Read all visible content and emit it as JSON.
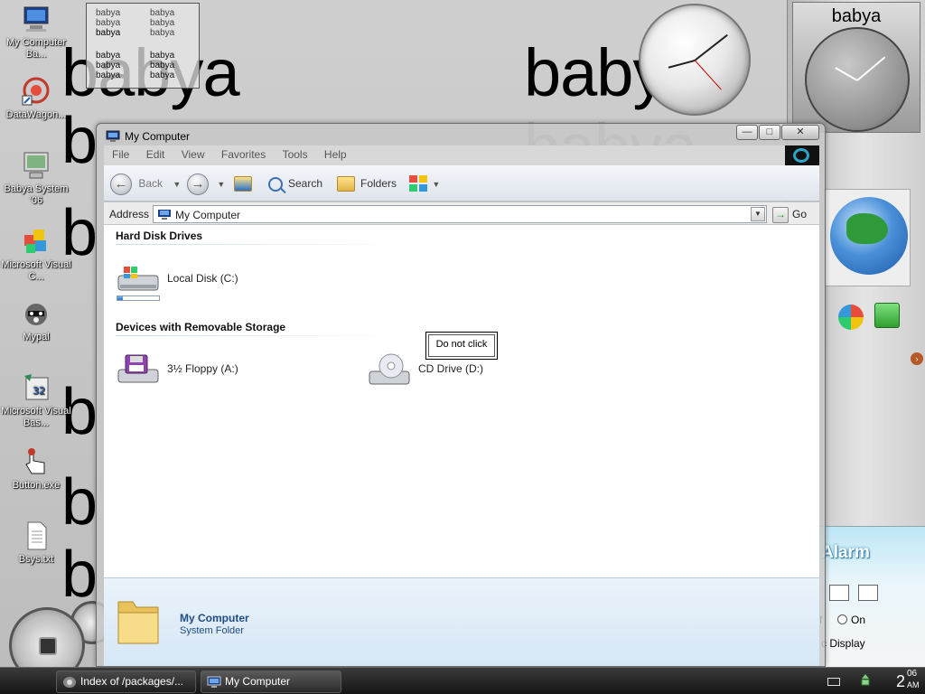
{
  "desktop": {
    "watermark_word": "babya",
    "icons": [
      {
        "label": "My Computer Ba..."
      },
      {
        "label": "DataWagon..."
      },
      {
        "label": "Babya System '06"
      },
      {
        "label": "Microsoft Visual C..."
      },
      {
        "label": "Mypal"
      },
      {
        "label": "Microsoft Visual Bas..."
      },
      {
        "label": "Button.exe"
      },
      {
        "label": "Bsys.txt"
      }
    ],
    "note_widget": {
      "col1": [
        "babya",
        "babya",
        "babya"
      ],
      "col2": [
        "babya",
        "babya",
        "babya"
      ],
      "col3": [
        "babya",
        "babya",
        "babya"
      ],
      "col4": [
        "babya",
        "babya",
        "babya"
      ]
    }
  },
  "gadgets": {
    "clock_title": "babya",
    "alarm": {
      "title": "Alarm",
      "radio_partial": "f",
      "radio_on": "On",
      "display_label": "c Display"
    }
  },
  "window": {
    "title": "My Computer",
    "buttons": {
      "minimize": "—",
      "maximize": "□",
      "close": "✕"
    },
    "menu": [
      "File",
      "Edit",
      "View",
      "Favorites",
      "Tools",
      "Help"
    ],
    "toolbar": {
      "back": "Back",
      "search": "Search",
      "folders": "Folders"
    },
    "address": {
      "label": "Address",
      "value": "My Computer",
      "go": "Go"
    },
    "groups": {
      "hard_disks": "Hard Disk Drives",
      "removable": "Devices with Removable Storage"
    },
    "drives": {
      "local_disk": "Local Disk (C:)",
      "local_disk_used_fraction": 0.12,
      "floppy": "3½ Floppy (A:)",
      "cd": "CD Drive (D:)"
    },
    "floating_button": "Do not click",
    "details": {
      "title": "My Computer",
      "subtitle": "System Folder"
    }
  },
  "taskbar": {
    "tasks": [
      {
        "label": "Index of /packages/..."
      },
      {
        "label": "My Computer"
      }
    ],
    "clock": {
      "hour": "2",
      "minute": "06",
      "ampm": "AM"
    }
  },
  "colors": {
    "details_text": "#1e4b82",
    "taskbar": "#1c1c1c",
    "capacity_fill": "#2a76c9"
  }
}
